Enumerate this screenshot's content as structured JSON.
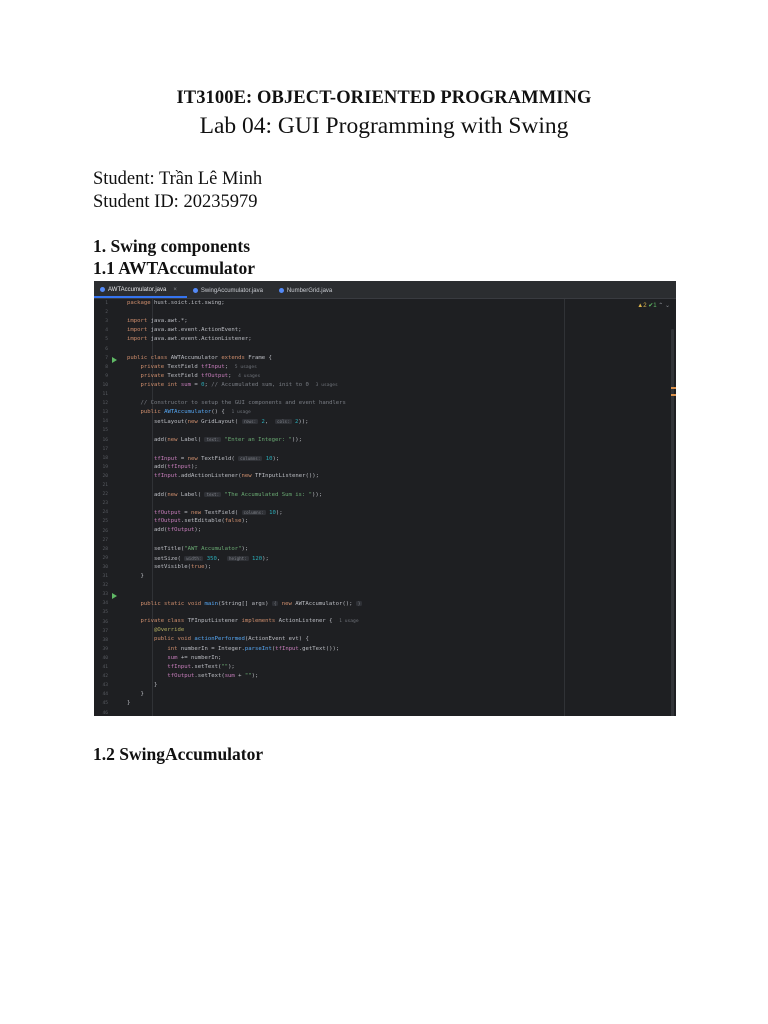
{
  "document": {
    "course": "IT3100E: OBJECT-ORIENTED PROGRAMMING",
    "lab_title": "Lab 04: GUI Programming with Swing",
    "student_line": "Student: Trần Lê Minh",
    "student_id_line": "Student ID: 20235979",
    "section_1": "1. Swing components",
    "section_1_1": "1.1 AWTAccumulator",
    "section_1_2": "1.2 SwingAccumulator"
  },
  "ide": {
    "tabs": [
      {
        "label": "AWTAccumulator.java",
        "active": true
      },
      {
        "label": "SwingAccumulator.java",
        "active": false
      },
      {
        "label": "NumberGrid.java",
        "active": false
      }
    ],
    "inspection": {
      "warnings": "▲2",
      "ok": "✔1"
    },
    "accent_color": "#3574f0",
    "background_color": "#1e1f22"
  }
}
